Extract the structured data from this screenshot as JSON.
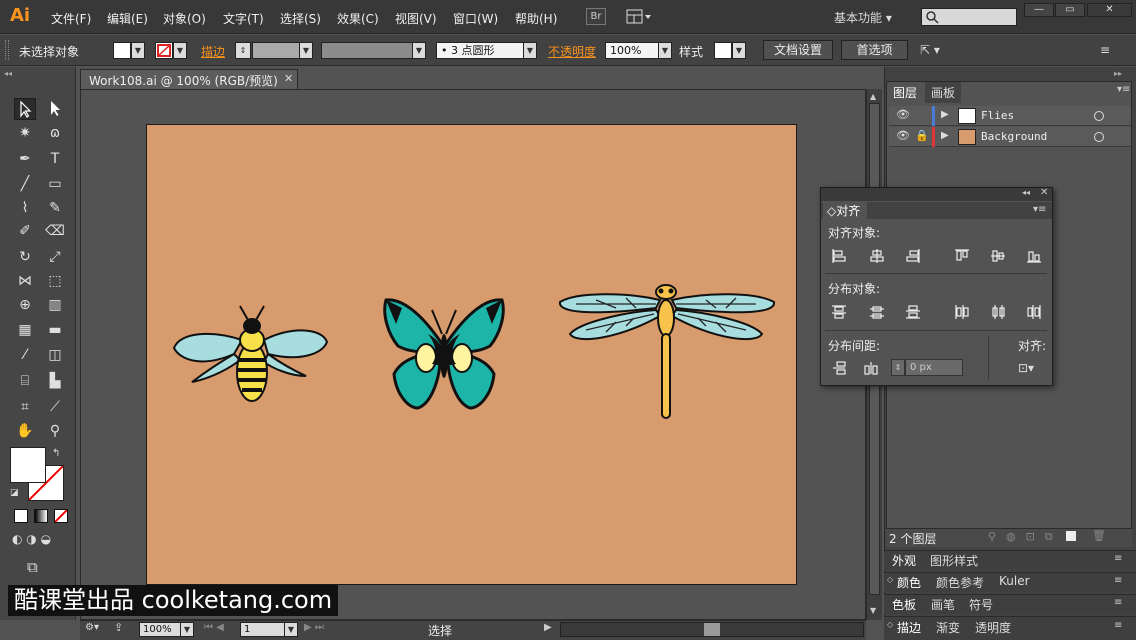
{
  "app": {
    "logo": "Ai",
    "workspace": "基本功能",
    "br_label": "Br"
  },
  "menu": [
    "文件(F)",
    "编辑(E)",
    "对象(O)",
    "文字(T)",
    "选择(S)",
    "效果(C)",
    "视图(V)",
    "窗口(W)",
    "帮助(H)"
  ],
  "control_bar": {
    "selection_status": "未选择对象",
    "stroke_label": "描边",
    "brush_value": "3 点圆形",
    "opacity_label": "不透明度",
    "opacity_value": "100%",
    "style_label": "样式",
    "doc_setup_button": "文档设置",
    "prefs_button": "首选项"
  },
  "document": {
    "tab_title": "Work108.ai @ 100% (RGB/预览)",
    "artboard_color": "#d89b6d"
  },
  "status_bar": {
    "zoom": "100%",
    "page": "1",
    "tool_status": "选择"
  },
  "layers_panel": {
    "tabs": [
      "图层",
      "画板"
    ],
    "layers": [
      {
        "name": "Flies",
        "color": "#4a7bd8",
        "locked": false
      },
      {
        "name": "Background",
        "color": "#e0343a",
        "locked": true
      }
    ],
    "count_label": "2 个图层"
  },
  "stacked_panels": [
    [
      "外观",
      "图形样式"
    ],
    [
      "颜色",
      "颜色参考",
      "Kuler"
    ],
    [
      "色板",
      "画笔",
      "符号"
    ],
    [
      "描边",
      "渐变",
      "透明度"
    ]
  ],
  "align_panel": {
    "title": "对齐",
    "align_objects_label": "对齐对象:",
    "distribute_objects_label": "分布对象:",
    "distribute_spacing_label": "分布间距:",
    "align_to_label": "对齐:",
    "spacing_value": "0 px"
  },
  "watermark": "酷课堂出品 coolketang.com"
}
